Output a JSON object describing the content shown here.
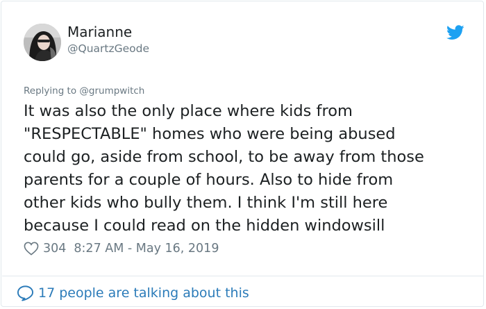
{
  "author": {
    "name": "Marianne",
    "handle": "@QuartzGeode",
    "avatar_icon": "profile-photo"
  },
  "reply_context": "Replying to @grumpwitch",
  "tweet_lines": [
    "It was also the only place where kids from",
    "\"RESPECTABLE\" homes who were being abused",
    "could go, aside from school, to be away from those",
    "parents for a couple of hours. Also to hide from",
    "other kids who bully them. I think I'm still here",
    "because I could read on the hidden windowsill"
  ],
  "meta": {
    "likes": "304",
    "timestamp": "8:27 AM - May 16, 2019"
  },
  "footer": {
    "text": "17 people are talking about this"
  },
  "colors": {
    "text": "#1c2022",
    "muted": "#697882",
    "link": "#2b7bb9",
    "twitter_blue": "#1da1f2",
    "border": "#e1e8ed"
  },
  "icons": [
    "twitter-bird-icon",
    "heart-icon",
    "speech-bubble-icon"
  ]
}
